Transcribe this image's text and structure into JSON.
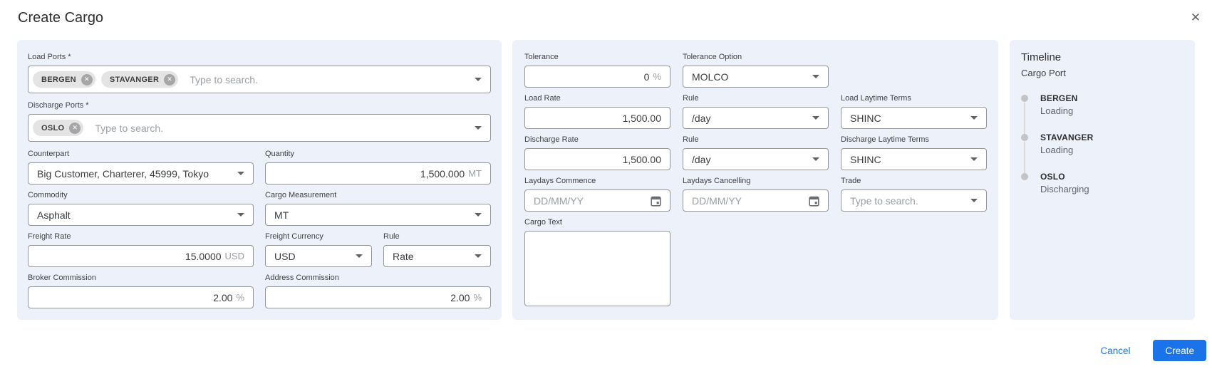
{
  "dialog": {
    "title": "Create Cargo"
  },
  "icons": {
    "close": "✕",
    "chip_remove": "✕"
  },
  "colors": {
    "accent_blue": "#1a73e8",
    "panel_bg": "#edf2fa",
    "border_gray": "#949699"
  },
  "left_panel": {
    "load_ports": {
      "label": "Load Ports *",
      "chips": [
        "BERGEN",
        "STAVANGER"
      ],
      "placeholder": "Type to search."
    },
    "discharge_ports": {
      "label": "Discharge Ports *",
      "chips": [
        "OSLO"
      ],
      "placeholder": "Type to search."
    },
    "counterpart": {
      "label": "Counterpart",
      "value": "Big Customer, Charterer, 45999, Tokyo"
    },
    "quantity": {
      "label": "Quantity",
      "value": "1,500.000",
      "suffix": "MT"
    },
    "commodity": {
      "label": "Commodity",
      "value": "Asphalt"
    },
    "cargo_measurement": {
      "label": "Cargo Measurement",
      "value": "MT"
    },
    "freight_rate": {
      "label": "Freight Rate",
      "value": "15.0000",
      "suffix": "USD"
    },
    "freight_currency": {
      "label": "Freight Currency",
      "value": "USD"
    },
    "freight_rule": {
      "label": "Rule",
      "value": "Rate"
    },
    "broker_commission": {
      "label": "Broker Commission",
      "value": "2.00",
      "suffix": "%"
    },
    "address_commission": {
      "label": "Address Commission",
      "value": "2.00",
      "suffix": "%"
    }
  },
  "middle_panel": {
    "tolerance": {
      "label": "Tolerance",
      "value": "0",
      "suffix": "%"
    },
    "tolerance_option": {
      "label": "Tolerance Option",
      "value": "MOLCO"
    },
    "load_rate": {
      "label": "Load Rate",
      "value": "1,500.00"
    },
    "load_rule": {
      "label": "Rule",
      "value": "/day"
    },
    "load_laytime_terms": {
      "label": "Load Laytime Terms",
      "value": "SHINC"
    },
    "discharge_rate": {
      "label": "Discharge Rate",
      "value": "1,500.00"
    },
    "discharge_rule": {
      "label": "Rule",
      "value": "/day"
    },
    "discharge_laytime_terms": {
      "label": "Discharge Laytime Terms",
      "value": "SHINC"
    },
    "laydays_commence": {
      "label": "Laydays Commence",
      "placeholder": "DD/MM/YY"
    },
    "laydays_cancelling": {
      "label": "Laydays Cancelling",
      "placeholder": "DD/MM/YY"
    },
    "trade": {
      "label": "Trade",
      "placeholder": "Type to search."
    },
    "cargo_text": {
      "label": "Cargo Text",
      "value": ""
    }
  },
  "timeline_panel": {
    "title": "Timeline",
    "subtitle": "Cargo Port",
    "items": [
      {
        "port": "BERGEN",
        "activity": "Loading"
      },
      {
        "port": "STAVANGER",
        "activity": "Loading"
      },
      {
        "port": "OSLO",
        "activity": "Discharging"
      }
    ]
  },
  "footer": {
    "cancel_label": "Cancel",
    "create_label": "Create"
  }
}
